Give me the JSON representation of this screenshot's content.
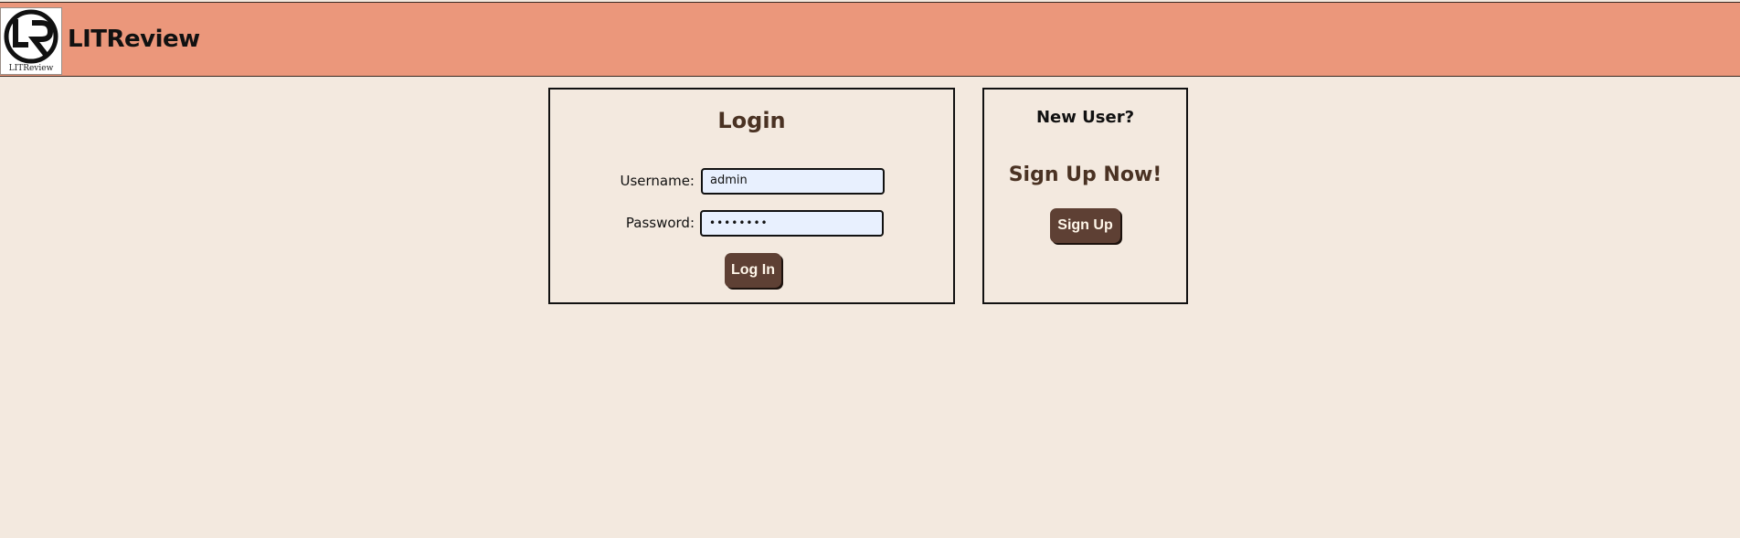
{
  "header": {
    "logo_caption": "LITReview",
    "title": "LITReview"
  },
  "login": {
    "title": "Login",
    "username_label": "Username:",
    "username_value": "admin",
    "password_label": "Password:",
    "password_value": "••••••••",
    "button_label": "Log In"
  },
  "signup": {
    "prompt": "New User?",
    "heading": "Sign Up Now!",
    "button_label": "Sign Up"
  },
  "colors": {
    "header_bg": "#eb977b",
    "page_bg": "#f3e9df",
    "button_bg": "#5e4034",
    "heading_text": "#4a3223",
    "input_bg": "#e8f0fe"
  }
}
